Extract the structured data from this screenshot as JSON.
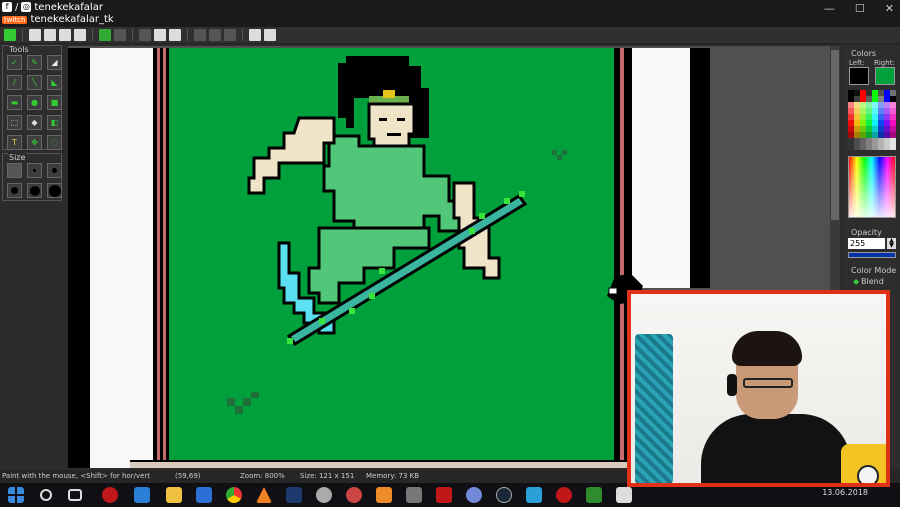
{
  "overlay": {
    "social_handle": "tenekekafalar",
    "twitch_label": "twitch",
    "twitch_handle": "tenekekafalar_tk"
  },
  "window_controls": {
    "minimize": "—",
    "maximize": "☐",
    "close": "✕"
  },
  "panels": {
    "tools_title": "Tools",
    "size_title": "Size",
    "colors_title": "Colors",
    "left_label": "Left:",
    "right_label": "Right:",
    "opacity_title": "Opacity",
    "opacity_value": "255",
    "color_mode_title": "Color Mode",
    "color_mode_value": "Blend"
  },
  "colors": {
    "left": "#000000",
    "right": "#00a13d",
    "canvas_bg": "#00a13d"
  },
  "status": {
    "hint": "Paint with the mouse, <Shift> for hor/vert",
    "coords": "(59,69)",
    "zoom": "Zoom: 800%",
    "size": "Size: 121 x 151",
    "memory": "Memory: 73 KB"
  },
  "taskbar": {
    "date": "13.06.2018"
  }
}
